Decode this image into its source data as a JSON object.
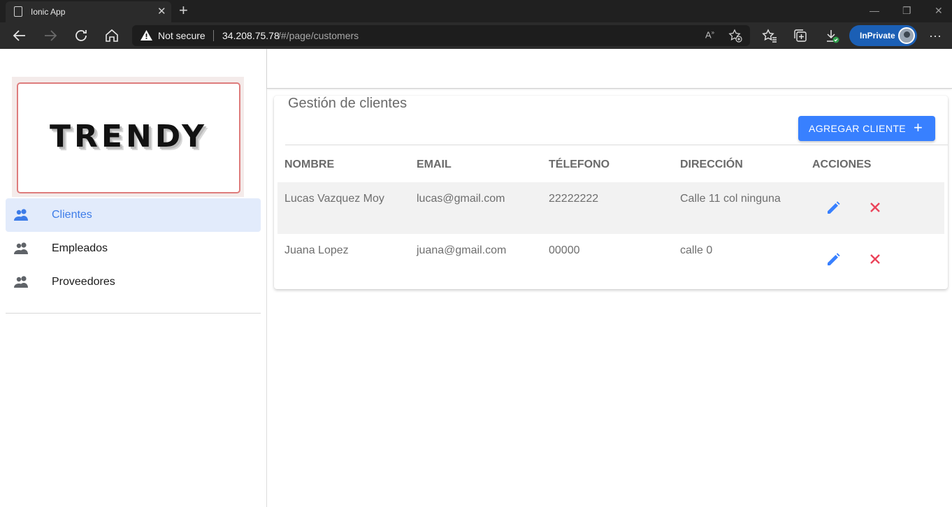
{
  "browser": {
    "tab_title": "Ionic App",
    "security_label": "Not secure",
    "url_host": "34.208.75.78",
    "url_path": "/#/page/customers",
    "inprivate_label": "InPrivate",
    "read_aloud_glyph": "A͈"
  },
  "sidebar": {
    "logo_text": "TRENDY",
    "items": [
      {
        "label": "Clientes",
        "icon": "people-icon",
        "active": true
      },
      {
        "label": "Empleados",
        "icon": "people-icon",
        "active": false
      },
      {
        "label": "Proveedores",
        "icon": "people-icon",
        "active": false
      }
    ]
  },
  "main": {
    "card_title": "Gestión de clientes",
    "add_button_label": "AGREGAR CLIENTE",
    "add_button_icon": "+",
    "table": {
      "headers": [
        "NOMBRE",
        "EMAIL",
        "TÉLEFONO",
        "DIRECCIÓN",
        "ACCIONES"
      ],
      "rows": [
        {
          "nombre": "Lucas Vazquez Moy",
          "email": "lucas@gmail.com",
          "telefono": "22222222",
          "direccion": "Calle 11 col ninguna"
        },
        {
          "nombre": "Juana Lopez",
          "email": "juana@gmail.com",
          "telefono": "00000",
          "direccion": "calle 0"
        }
      ]
    }
  },
  "colors": {
    "accent": "#3880ff",
    "active_menu_bg": "#e2ebfb",
    "active_menu_text": "#3d7ce8",
    "delete_icon": "#eb445a",
    "edit_icon": "#3880ff"
  }
}
